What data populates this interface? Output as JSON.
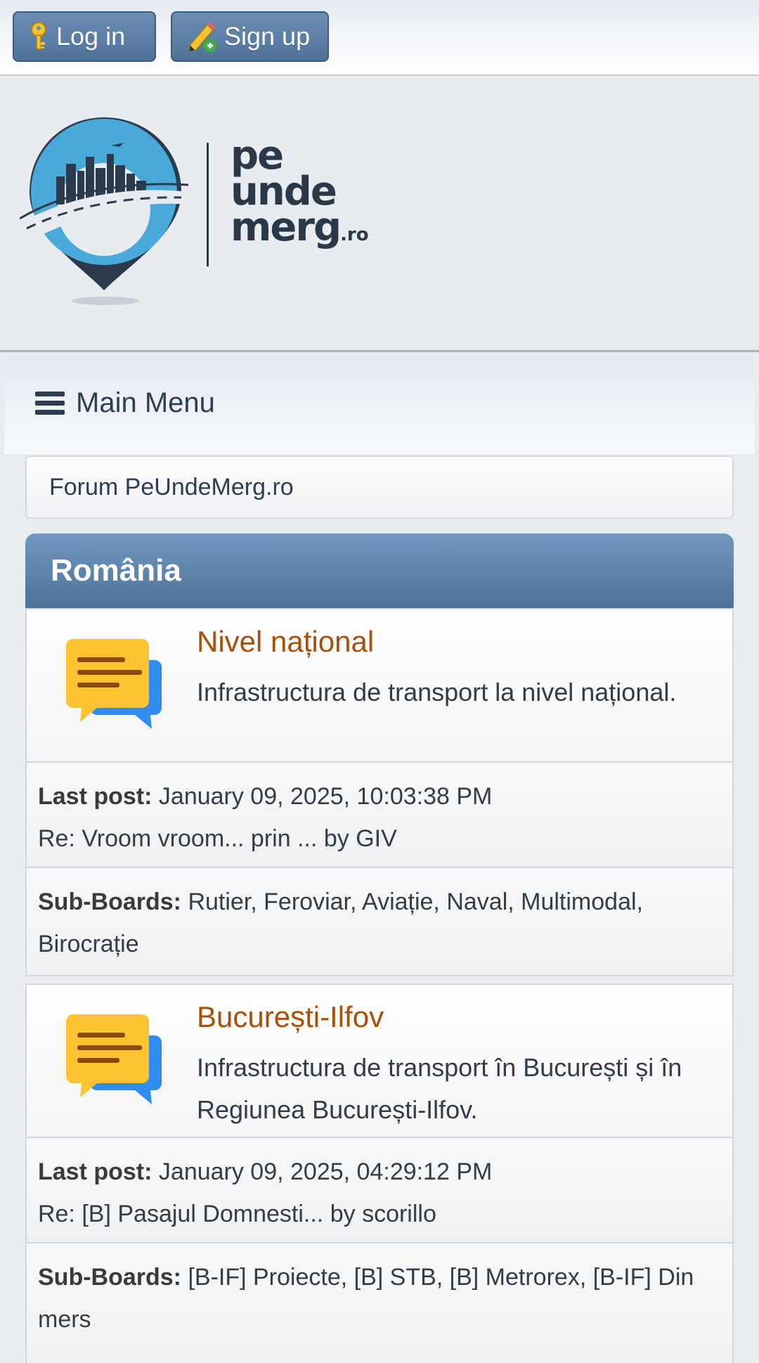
{
  "topbar": {
    "login_label": "Log in",
    "signup_label": "Sign up"
  },
  "logo": {
    "line1": "pe",
    "line2": "unde",
    "line3": "merg",
    "suffix": ".ro"
  },
  "menu": {
    "label": "Main Menu"
  },
  "breadcrumb": {
    "label": "Forum PeUndeMerg.ro"
  },
  "category": {
    "title": "România"
  },
  "boards": [
    {
      "title": "Nivel național",
      "description": "Infrastructura de transport la nivel național.",
      "last_post_label": "Last post:",
      "last_post_date": "January 09, 2025, 10:03:38 PM",
      "last_post_text": "Re: Vroom vroom... prin ... by GIV",
      "subboards_label": "Sub-Boards:",
      "subboards": "Rutier, Feroviar, Aviație, Naval, Multimodal, Birocrație"
    },
    {
      "title": "București-Ilfov",
      "description": "Infrastructura de transport în București și în Regiunea București-Ilfov.",
      "last_post_label": "Last post:",
      "last_post_date": "January 09, 2025, 04:29:12 PM",
      "last_post_text": "Re: [B] Pasajul Domnesti... by scorillo",
      "subboards_label": "Sub-Boards:",
      "subboards": "[B-IF] Proiecte, [B] STB, [B] Metrorex, [B-IF] Din mers"
    }
  ],
  "icons": {
    "login": "key-icon",
    "signup": "pencil-add-icon",
    "menu": "hamburger-icon",
    "board": "chat-bubbles-icon"
  },
  "colors": {
    "accent": "#4f7299",
    "board_title": "#a95008",
    "category_header": "#5d83a9"
  }
}
